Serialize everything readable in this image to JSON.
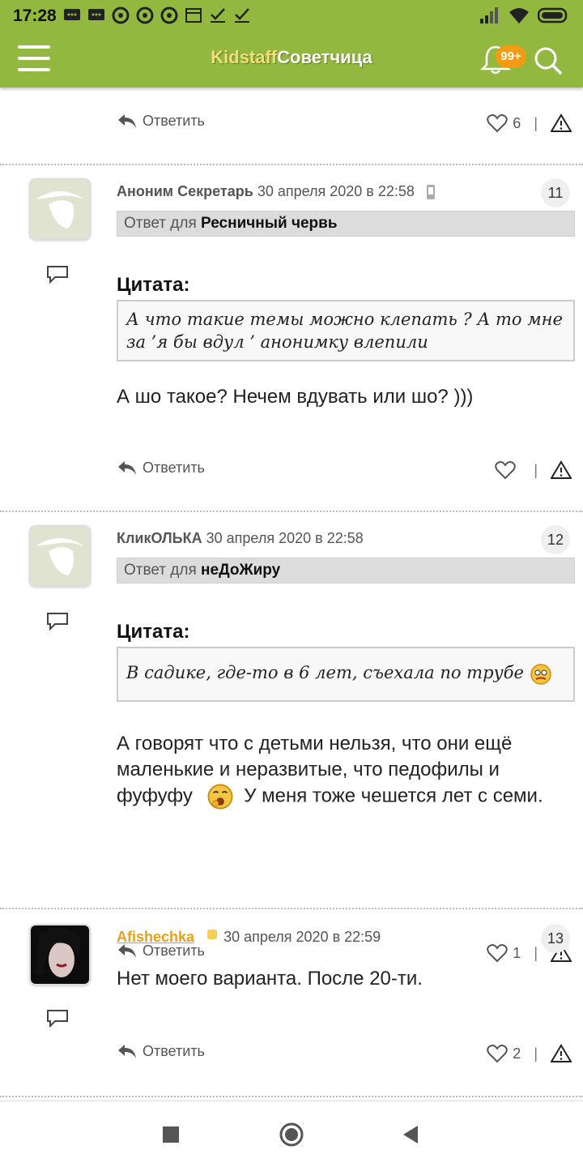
{
  "status": {
    "time": "17:28"
  },
  "app": {
    "logo_k": "Kidstaff",
    "logo_s": "Советчица",
    "badge": "99+"
  },
  "top_reply": {
    "reply_label": "Ответить",
    "likes": "6"
  },
  "comments": [
    {
      "author": "Аноним Секретарь",
      "date": "30 апреля 2020 в 22:58",
      "number": "11",
      "reply_prefix": "Ответ для",
      "reply_to": "Ресничный червь",
      "quote_title": "Цитата:",
      "quote": "А что такие темы можно клепать ? А то мне за ’я бы вдул ’ анонимку влепили",
      "body": "А шо такое? Нечем вдувать или шо? )))",
      "reply_label": "Ответить",
      "likes": ""
    },
    {
      "author": "КликОЛЬКА",
      "date": "30 апреля 2020 в 22:58",
      "number": "12",
      "reply_prefix": "Ответ для",
      "reply_to": "неДоЖиру",
      "quote_title": "Цитата:",
      "quote": "В садике, где-то в 6 лет, съехала по трубе",
      "body_line1": "А говорят что с детьми нельзя, что они ещё маленькие и неразвитые, что педофилы и",
      "body_word": "фуфуфу",
      "body_after": "У меня тоже чешется лет с семи.",
      "reply_label": "Ответить",
      "likes": "1"
    },
    {
      "author": "Afishechka",
      "date": "30 апреля 2020 в 22:59",
      "number": "13",
      "body": "Нет моего варианта. После 20-ти.",
      "reply_label": "Ответить",
      "likes": "2"
    }
  ],
  "colors": {
    "header": "#93b83f",
    "badge": "#f39c12",
    "author_link": "#e6a117"
  }
}
